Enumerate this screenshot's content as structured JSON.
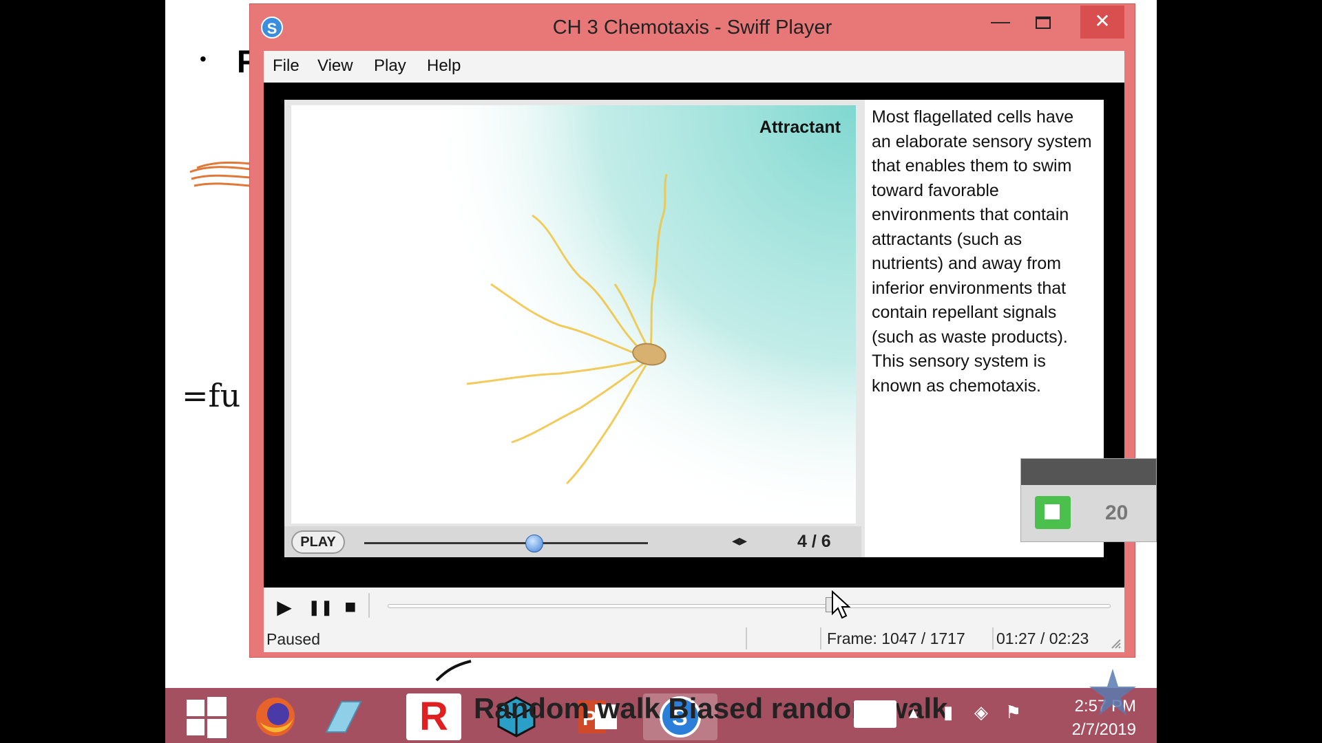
{
  "background": {
    "bullet_char": "•",
    "bullet_letter": "F",
    "handwriting": "=fu"
  },
  "window": {
    "title": "CH 3 Chemotaxis - Swiff Player",
    "app_icon": "swiff-player-icon",
    "minimize_icon": "minimize-icon",
    "maximize_icon": "maximize-icon",
    "close_icon": "close-icon",
    "close_glyph": "✕",
    "minimize_glyph": "—"
  },
  "menu": [
    "File",
    "View",
    "Play",
    "Help"
  ],
  "animation": {
    "label": "Attractant",
    "description": "Most flagellated cells have an elaborate sensory system that enables them to swim toward favorable environments that contain attractants (such as nutrients) and away from inferior environments that contain repellant signals (such as waste products). This sensory system is known as chemotaxis.",
    "play_label": "PLAY",
    "nav_arrows": "◂▸",
    "page": "4 / 6",
    "slider_fraction": 0.6,
    "gradient_color": "#7fd8d0",
    "flagella_color": "#f0c64a"
  },
  "transport": {
    "play_icon": "play-icon",
    "pause_icon": "pause-icon",
    "stop_icon": "stop-icon",
    "play_glyph": "▶",
    "pause_glyph": "❚❚",
    "stop_glyph": "■",
    "seek_fraction": 0.61
  },
  "status": {
    "state": "Paused",
    "frame": "Frame: 1047 / 1717",
    "time": "01:27 / 02:23"
  },
  "recorder": {
    "value": "20",
    "color": "#4cc04c"
  },
  "taskbar": {
    "overlay_text": "Random walk Biased random walk",
    "apps": [
      "windows-start-icon",
      "firefox-icon",
      "notepad-icon",
      "r-app-icon",
      "cube-app-icon",
      "powerpoint-icon",
      "swiff-player-taskbar-icon"
    ],
    "time": "2:57 PM",
    "date": "2/7/2019"
  }
}
